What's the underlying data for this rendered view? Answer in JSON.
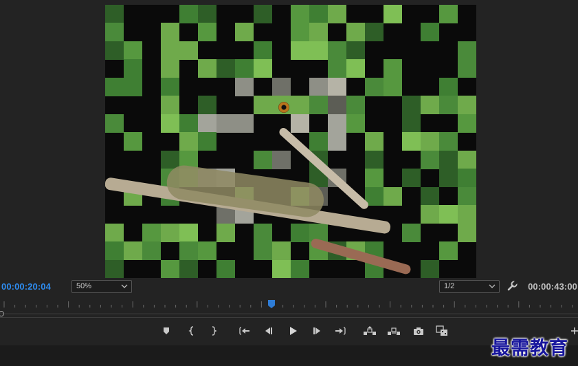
{
  "program_monitor": {
    "current_timecode": "00:00:20:04",
    "duration_timecode": "00:00:43:00",
    "zoom_level": "50%",
    "resolution": "1/2",
    "playhead_position_fraction": 0.47,
    "accent_color": "#2e8cf0"
  },
  "frame": {
    "subject": "chameleon on branch",
    "transition_effect": "random blocks reveal"
  },
  "transport_controls": [
    {
      "name": "add-marker",
      "icon": "marker-icon"
    },
    {
      "name": "mark-in",
      "icon": "mark-in-icon"
    },
    {
      "name": "mark-out",
      "icon": "mark-out-icon"
    },
    {
      "name": "go-to-in",
      "icon": "go-to-in-icon"
    },
    {
      "name": "step-back",
      "icon": "step-back-icon"
    },
    {
      "name": "play-stop",
      "icon": "play-icon"
    },
    {
      "name": "step-forward",
      "icon": "step-forward-icon"
    },
    {
      "name": "go-to-out",
      "icon": "go-to-out-icon"
    },
    {
      "name": "lift",
      "icon": "lift-icon"
    },
    {
      "name": "extract",
      "icon": "extract-icon"
    },
    {
      "name": "export-frame",
      "icon": "camera-icon"
    },
    {
      "name": "compare-view",
      "icon": "compare-icon"
    }
  ],
  "watermark": "最需教育"
}
